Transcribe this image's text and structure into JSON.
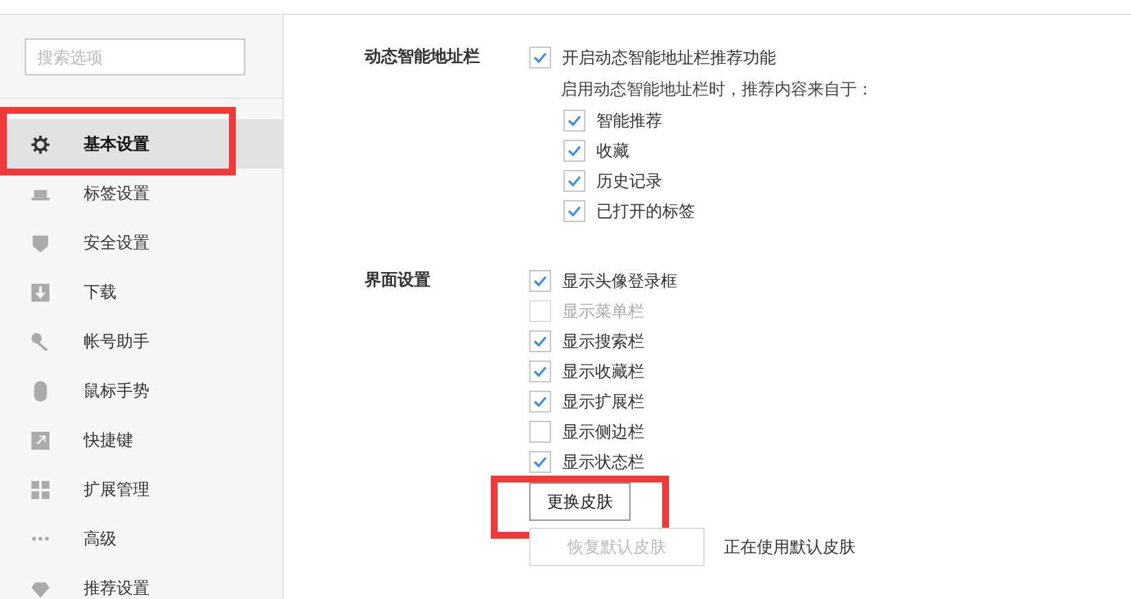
{
  "sidebar": {
    "search": {
      "placeholder": "搜索选项"
    },
    "items": [
      {
        "label": "基本设置",
        "selected": true
      },
      {
        "label": "标签设置",
        "selected": false
      },
      {
        "label": "安全设置",
        "selected": false
      },
      {
        "label": "下载",
        "selected": false
      },
      {
        "label": "帐号助手",
        "selected": false
      },
      {
        "label": "鼠标手势",
        "selected": false
      },
      {
        "label": "快捷键",
        "selected": false
      },
      {
        "label": "扩展管理",
        "selected": false
      },
      {
        "label": "高级",
        "selected": false
      },
      {
        "label": "推荐设置",
        "selected": false
      }
    ]
  },
  "sections": [
    {
      "title": "动态智能地址栏",
      "main": {
        "label": "开启动态智能地址栏推荐功能",
        "checked": true
      },
      "note": "启用动态智能地址栏时，推荐内容来自于：",
      "options": [
        {
          "label": "智能推荐",
          "checked": true
        },
        {
          "label": "收藏",
          "checked": true
        },
        {
          "label": "历史记录",
          "checked": true
        },
        {
          "label": "已打开的标签",
          "checked": true
        }
      ]
    },
    {
      "title": "界面设置",
      "options": [
        {
          "label": "显示头像登录框",
          "checked": true,
          "disabled": false
        },
        {
          "label": "显示菜单栏",
          "checked": false,
          "disabled": true
        },
        {
          "label": "显示搜索栏",
          "checked": true,
          "disabled": false
        },
        {
          "label": "显示收藏栏",
          "checked": true,
          "disabled": false
        },
        {
          "label": "显示扩展栏",
          "checked": true,
          "disabled": false
        },
        {
          "label": "显示侧边栏",
          "checked": false,
          "disabled": false
        },
        {
          "label": "显示状态栏",
          "checked": true,
          "disabled": false
        }
      ],
      "skin_button": "更换皮肤",
      "restore_button": {
        "label": "恢复默认皮肤",
        "disabled": true
      },
      "skin_status": "正在使用默认皮肤"
    }
  ]
}
